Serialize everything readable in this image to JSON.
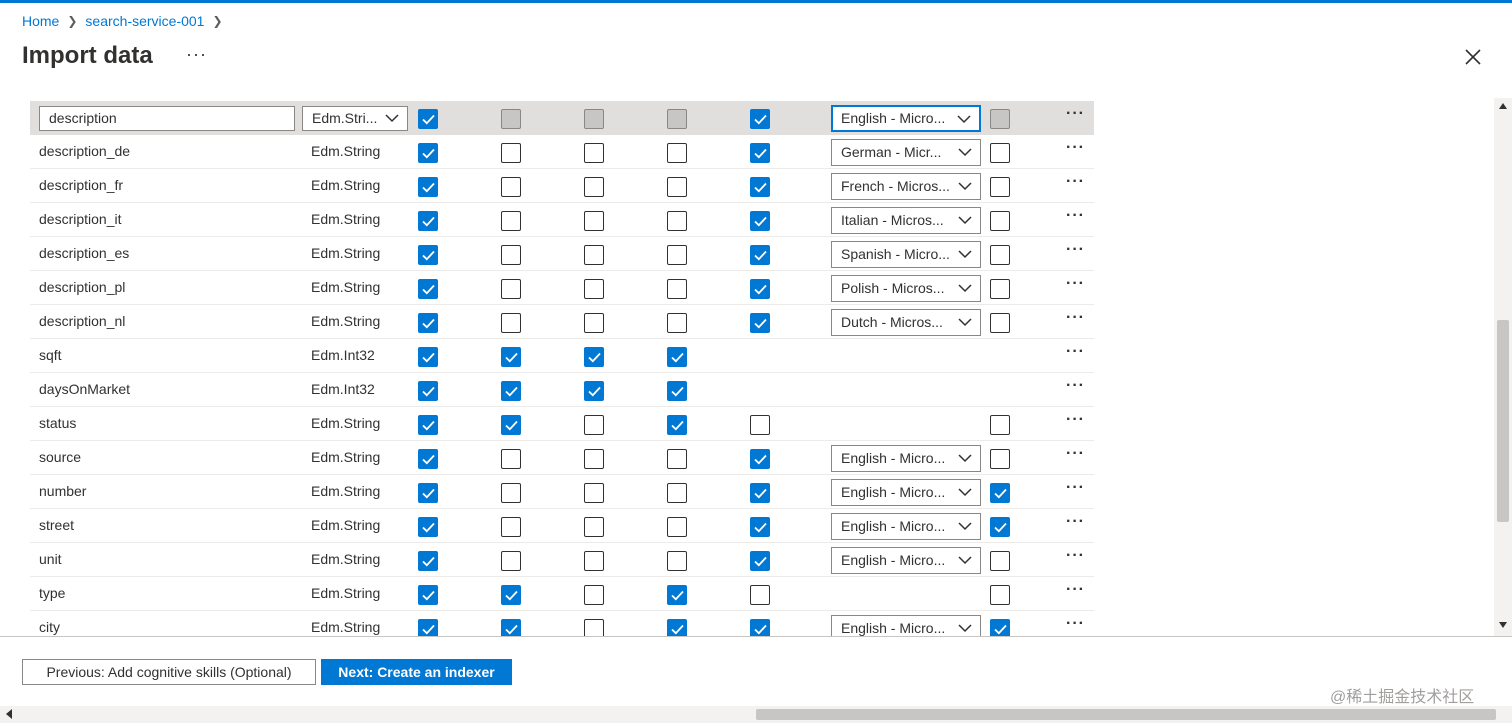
{
  "breadcrumb": {
    "home": "Home",
    "service": "search-service-001"
  },
  "page": {
    "title": "Import data",
    "more": "···"
  },
  "grid": {
    "rows": [
      {
        "name": "description",
        "type": "Edm.Stri...",
        "editing": true,
        "checks": [
          true,
          false,
          false,
          false,
          true
        ],
        "lang": "English - Micro...",
        "last": false,
        "disabled_cols": [
          1,
          2,
          3,
          5
        ]
      },
      {
        "name": "description_de",
        "type": "Edm.String",
        "checks": [
          true,
          false,
          false,
          false,
          true
        ],
        "lang": "German - Micr...",
        "last": false
      },
      {
        "name": "description_fr",
        "type": "Edm.String",
        "checks": [
          true,
          false,
          false,
          false,
          true
        ],
        "lang": "French - Micros...",
        "last": false
      },
      {
        "name": "description_it",
        "type": "Edm.String",
        "checks": [
          true,
          false,
          false,
          false,
          true
        ],
        "lang": "Italian - Micros...",
        "last": false
      },
      {
        "name": "description_es",
        "type": "Edm.String",
        "checks": [
          true,
          false,
          false,
          false,
          true
        ],
        "lang": "Spanish - Micro...",
        "last": false
      },
      {
        "name": "description_pl",
        "type": "Edm.String",
        "checks": [
          true,
          false,
          false,
          false,
          true
        ],
        "lang": "Polish - Micros...",
        "last": false
      },
      {
        "name": "description_nl",
        "type": "Edm.String",
        "checks": [
          true,
          false,
          false,
          false,
          true
        ],
        "lang": "Dutch - Micros...",
        "last": false
      },
      {
        "name": "sqft",
        "type": "Edm.Int32",
        "checks": [
          true,
          true,
          true,
          true,
          null
        ],
        "lang": null,
        "last": null
      },
      {
        "name": "daysOnMarket",
        "type": "Edm.Int32",
        "checks": [
          true,
          true,
          true,
          true,
          null
        ],
        "lang": null,
        "last": null
      },
      {
        "name": "status",
        "type": "Edm.String",
        "checks": [
          true,
          true,
          false,
          true,
          false
        ],
        "lang": null,
        "last": false
      },
      {
        "name": "source",
        "type": "Edm.String",
        "checks": [
          true,
          false,
          false,
          false,
          true
        ],
        "lang": "English - Micro...",
        "last": false
      },
      {
        "name": "number",
        "type": "Edm.String",
        "checks": [
          true,
          false,
          false,
          false,
          true
        ],
        "lang": "English - Micro...",
        "last": true
      },
      {
        "name": "street",
        "type": "Edm.String",
        "checks": [
          true,
          false,
          false,
          false,
          true
        ],
        "lang": "English - Micro...",
        "last": true
      },
      {
        "name": "unit",
        "type": "Edm.String",
        "checks": [
          true,
          false,
          false,
          false,
          true
        ],
        "lang": "English - Micro...",
        "last": false
      },
      {
        "name": "type",
        "type": "Edm.String",
        "checks": [
          true,
          true,
          false,
          true,
          false
        ],
        "lang": null,
        "last": false
      },
      {
        "name": "city",
        "type": "Edm.String",
        "checks": [
          true,
          true,
          false,
          true,
          true
        ],
        "lang": "English - Micro...",
        "last": true
      }
    ]
  },
  "footer": {
    "prev_label": "Previous: Add cognitive skills (Optional)",
    "next_label": "Next: Create an indexer",
    "watermark": "@稀土掘金技术社区"
  },
  "colors": {
    "accent": "#0078d4",
    "selected_row": "#e1dfdd"
  }
}
